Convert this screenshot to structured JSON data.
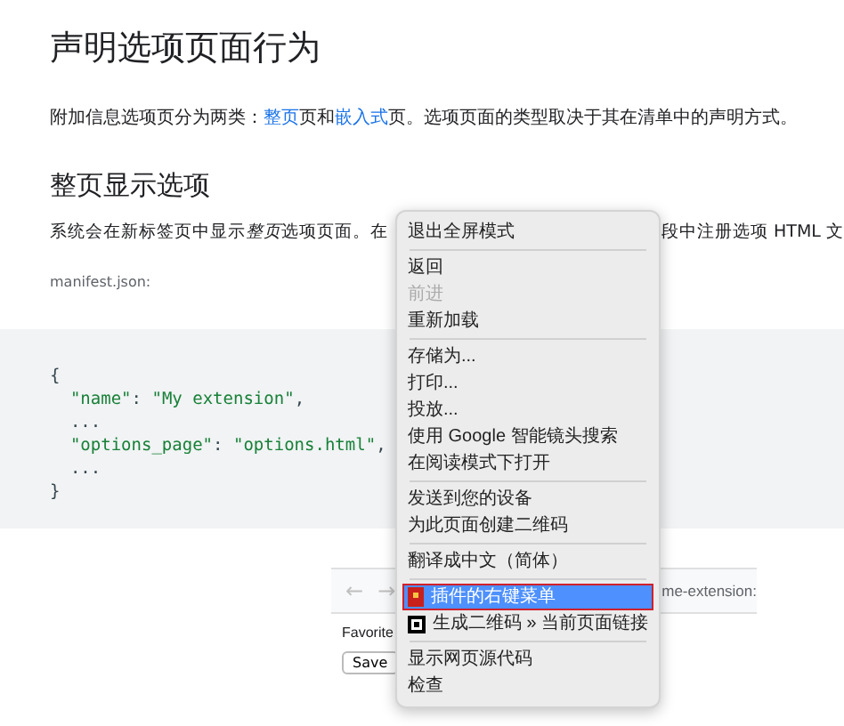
{
  "title": "声明选项页面行为",
  "intro": [
    {
      "kind": "text",
      "text": "附加信息选项页分为两类："
    },
    {
      "kind": "link",
      "text": "整页"
    },
    {
      "kind": "text",
      "text": "页和"
    },
    {
      "kind": "link",
      "text": "嵌入式"
    },
    {
      "kind": "text",
      "text": "页。选项页面的类型取决于其在清单中的声明方式。"
    }
  ],
  "section_heading": "整页显示选项",
  "section_text_left": [
    {
      "kind": "text",
      "text": "系统会在新标签页中显示"
    },
    {
      "kind": "em",
      "text": "整页"
    },
    {
      "kind": "text",
      "text": "选项页面。在"
    }
  ],
  "section_text_right": "段中注册选项 HTML 文",
  "file_label": "manifest.json:",
  "code_lines": [
    "{",
    "  \"name\": \"My extension\",",
    "  ...",
    "  \"options_page\": \"options.html\",",
    "  ...",
    "}"
  ],
  "preview": {
    "back": "←",
    "forward": "→",
    "url": "me-extension:",
    "label": "Favorite",
    "button": "Save"
  },
  "context_menu": [
    [
      {
        "label": "退出全屏模式",
        "disabled": false,
        "selected": false
      }
    ],
    [
      {
        "label": "返回",
        "disabled": false,
        "selected": false
      },
      {
        "label": "前进",
        "disabled": true,
        "selected": false
      },
      {
        "label": "重新加载",
        "disabled": false,
        "selected": false
      }
    ],
    [
      {
        "label": "存储为...",
        "disabled": false,
        "selected": false
      },
      {
        "label": "打印...",
        "disabled": false,
        "selected": false
      },
      {
        "label": "投放...",
        "disabled": false,
        "selected": false
      },
      {
        "label": "使用 Google 智能镜头搜索",
        "disabled": false,
        "selected": false
      },
      {
        "label": "在阅读模式下打开",
        "disabled": false,
        "selected": false
      }
    ],
    [
      {
        "label": "发送到您的设备",
        "disabled": false,
        "selected": false
      },
      {
        "label": "为此页面创建二维码",
        "disabled": false,
        "selected": false
      }
    ],
    [
      {
        "label": "翻译成中文（简体）",
        "disabled": false,
        "selected": false
      }
    ],
    [
      {
        "label": "插件的右键菜单",
        "disabled": false,
        "selected": true,
        "kind": "extension"
      },
      {
        "label": "生成二维码 » 当前页面链接",
        "disabled": false,
        "selected": false,
        "kind": "qr"
      }
    ],
    [
      {
        "label": "显示网页源代码",
        "disabled": false,
        "selected": false
      },
      {
        "label": "检查",
        "disabled": false,
        "selected": false
      }
    ]
  ]
}
